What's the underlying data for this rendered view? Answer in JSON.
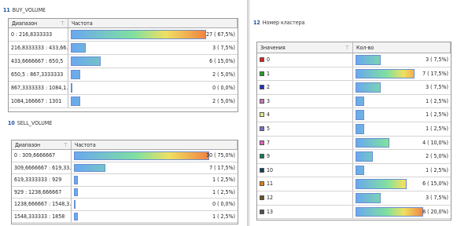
{
  "buy": {
    "num": "11",
    "title": "BUY_VOLUME",
    "col1": "Диапазон",
    "col2": "Частота",
    "rows": [
      {
        "label": "0 : 216,8333333",
        "count": 27,
        "value": "27 ( 67,5%)",
        "frac": 1.0
      },
      {
        "label": "216,8333333 : 433,66...",
        "count": 3,
        "value": "3 ( 7,5%)",
        "frac": 0.11
      },
      {
        "label": "433,6666667 : 650,5",
        "count": 6,
        "value": "6 ( 15,0%)",
        "frac": 0.22
      },
      {
        "label": "650,5 : 867,3333333",
        "count": 2,
        "value": "2 ( 5,0%)",
        "frac": 0.07
      },
      {
        "label": "867,3333333 : 1084,1...",
        "count": 0,
        "value": "0 ( 0,0%)",
        "frac": 0.0
      },
      {
        "label": "1084,166667 : 1301",
        "count": 2,
        "value": "2 ( 5,0%)",
        "frac": 0.07
      }
    ]
  },
  "sell": {
    "num": "10",
    "title": "SELL_VOLUME",
    "col1": "Диапазон",
    "col2": "Частота",
    "rows": [
      {
        "label": "0 : 309,6666667",
        "count": 30,
        "value": "30 ( 75,0%)",
        "frac": 1.0
      },
      {
        "label": "309,6666667 : 619,33...",
        "count": 7,
        "value": "7 ( 17,5%)",
        "frac": 0.23
      },
      {
        "label": "619,3333333 : 929",
        "count": 1,
        "value": "1 ( 2,5%)",
        "frac": 0.03
      },
      {
        "label": "929 : 1238,666667",
        "count": 1,
        "value": "1 ( 2,5%)",
        "frac": 0.03
      },
      {
        "label": "1238,666667 : 1548,3...",
        "count": 0,
        "value": "0 ( 0,0%)",
        "frac": 0.0
      },
      {
        "label": "1548,333333 : 1858",
        "count": 1,
        "value": "1 ( 2,5%)",
        "frac": 0.03
      }
    ]
  },
  "cluster": {
    "num": "12",
    "title": "Номер кластера",
    "col1": "Значения",
    "col2": "Кол-во",
    "selected_index": 12,
    "rows": [
      {
        "label": "0",
        "color": "#e02020",
        "value": "3 ( 7,5%)",
        "frac": 0.375
      },
      {
        "label": "1",
        "color": "#20a020",
        "value": "7 ( 17,5%)",
        "frac": 0.875
      },
      {
        "label": "2",
        "color": "#2030c0",
        "value": "3 ( 7,5%)",
        "frac": 0.375
      },
      {
        "label": "3",
        "color": "#d070c0",
        "value": "1 ( 2,5%)",
        "frac": 0.125
      },
      {
        "label": "4",
        "color": "#e8e890",
        "value": "1 ( 2,5%)",
        "frac": 0.125
      },
      {
        "label": "5",
        "color": "#7070d0",
        "value": "1 ( 2,5%)",
        "frac": 0.125
      },
      {
        "label": "7",
        "color": "#e060c0",
        "value": "4 ( 10,0%)",
        "frac": 0.5
      },
      {
        "label": "9",
        "color": "#108050",
        "value": "2 ( 5,0%)",
        "frac": 0.25
      },
      {
        "label": "10",
        "color": "#104060",
        "value": "1 ( 2,5%)",
        "frac": 0.125
      },
      {
        "label": "11",
        "color": "#e08010",
        "value": "6 ( 15,0%)",
        "frac": 0.75
      },
      {
        "label": "12",
        "color": "#6a5020",
        "value": "3 ( 7,5%)",
        "frac": 0.375
      },
      {
        "label": "13",
        "color": "#505050",
        "value": "8 ( 20,0%)",
        "frac": 1.0
      }
    ]
  },
  "colors": {
    "gradient_low": "#6aa8f0",
    "gradient_mid": "#7fe0a0",
    "gradient_high": "#f08040",
    "selection": "#3b8ee0"
  }
}
